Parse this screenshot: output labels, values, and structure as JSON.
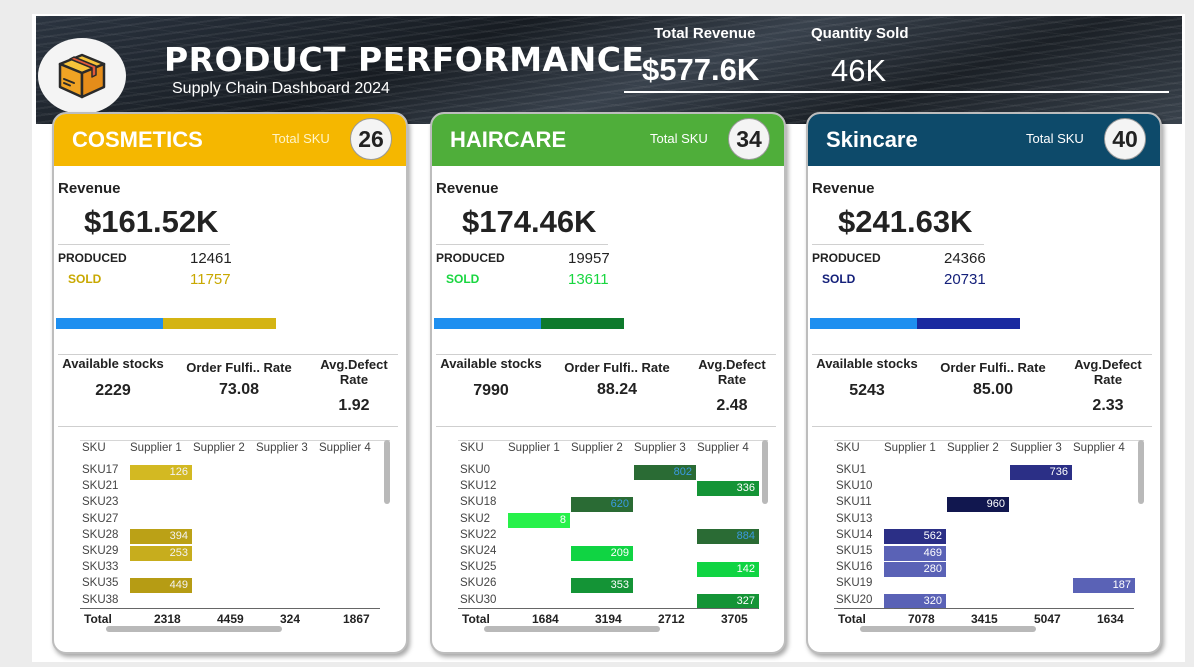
{
  "header": {
    "title": "PRODUCT PERFORMANCE",
    "subtitle": "Supply Chain Dashboard 2024",
    "logo_icon": "package-box-icon",
    "kpis": [
      {
        "label": "Total Revenue",
        "value": "$577.6K"
      },
      {
        "label": "Quantity Sold",
        "value": "46K"
      }
    ]
  },
  "labels": {
    "total_sku": "Total SKU",
    "revenue": "Revenue",
    "produced": "PRODUCED",
    "sold": "SOLD",
    "available_stocks": "Available stocks",
    "order_fulfil_rate": "Order Fulfi.. Rate",
    "avg_defect_rate": "Avg.Defect Rate",
    "sku": "SKU",
    "total": "Total",
    "suppliers": [
      "Supplier 1",
      "Supplier 2",
      "Supplier 3",
      "Supplier 4"
    ]
  },
  "cards": [
    {
      "name": "COSMETICS",
      "total_sku": "26",
      "revenue": "$161.52K",
      "produced": "12461",
      "sold": "11757",
      "sold_fraction": 0.9435,
      "available_stocks": "2229",
      "order_fulfil_rate": "73.08",
      "avg_defect_rate": "1.92",
      "colors": {
        "head": "#f5b700",
        "accent": "#d4b413",
        "produced_bar": "#1e8ff0",
        "sold_label": "#c8a800"
      },
      "matrix": {
        "rows": [
          "SKU17",
          "SKU21",
          "SKU23",
          "SKU27",
          "SKU28",
          "SKU29",
          "SKU33",
          "SKU35",
          "SKU38"
        ],
        "values": [
          [
            "126",
            "",
            "",
            ""
          ],
          [
            "",
            "",
            "",
            ""
          ],
          [
            "",
            "",
            "",
            ""
          ],
          [
            "",
            "",
            "",
            ""
          ],
          [
            "394",
            "",
            "",
            ""
          ],
          [
            "253",
            "",
            "",
            ""
          ],
          [
            "",
            "",
            "",
            ""
          ],
          [
            "449",
            "",
            "",
            ""
          ],
          [
            "",
            "",
            "",
            ""
          ]
        ],
        "totals": [
          "2318",
          "4459",
          "324",
          "1867"
        ]
      }
    },
    {
      "name": "HAIRCARE",
      "total_sku": "34",
      "revenue": "$174.46K",
      "produced": "19957",
      "sold": "13611",
      "sold_fraction": 0.682,
      "available_stocks": "7990",
      "order_fulfil_rate": "88.24",
      "avg_defect_rate": "2.48",
      "colors": {
        "head": "#4fae3a",
        "accent": "#0e7a2c",
        "produced_bar": "#1e8ff0",
        "sold_label": "#19d640"
      },
      "matrix": {
        "rows": [
          "SKU0",
          "SKU12",
          "SKU18",
          "SKU2",
          "SKU22",
          "SKU24",
          "SKU25",
          "SKU26",
          "SKU30"
        ],
        "values": [
          [
            "",
            "",
            "802",
            ""
          ],
          [
            "",
            "",
            "",
            "336"
          ],
          [
            "",
            "620",
            "",
            ""
          ],
          [
            "8",
            "",
            "",
            ""
          ],
          [
            "",
            "",
            "",
            "884"
          ],
          [
            "",
            "209",
            "",
            ""
          ],
          [
            "",
            "",
            "",
            "142"
          ],
          [
            "",
            "353",
            "",
            ""
          ],
          [
            "",
            "",
            "",
            "327"
          ]
        ],
        "totals": [
          "1684",
          "3194",
          "2712",
          "3705"
        ]
      }
    },
    {
      "name": "Skincare",
      "total_sku": "40",
      "revenue": "$241.63K",
      "produced": "24366",
      "sold": "20731",
      "sold_fraction": 0.8508,
      "available_stocks": "5243",
      "order_fulfil_rate": "85.00",
      "avg_defect_rate": "2.33",
      "colors": {
        "head": "#0d4a6a",
        "accent": "#1a2aa0",
        "produced_bar": "#1e8ff0",
        "sold_label": "#14207a"
      },
      "matrix": {
        "rows": [
          "SKU1",
          "SKU10",
          "SKU11",
          "SKU13",
          "SKU14",
          "SKU15",
          "SKU16",
          "SKU19",
          "SKU20"
        ],
        "values": [
          [
            "",
            "",
            "736",
            ""
          ],
          [
            "",
            "",
            "",
            ""
          ],
          [
            "",
            "960",
            "",
            ""
          ],
          [
            "",
            "",
            "",
            ""
          ],
          [
            "562",
            "",
            "",
            ""
          ],
          [
            "469",
            "",
            "",
            ""
          ],
          [
            "280",
            "",
            "",
            ""
          ],
          [
            "",
            "",
            "",
            "187"
          ],
          [
            "320",
            "",
            "",
            ""
          ]
        ],
        "totals": [
          "7078",
          "3415",
          "5047",
          "1634"
        ]
      }
    }
  ]
}
